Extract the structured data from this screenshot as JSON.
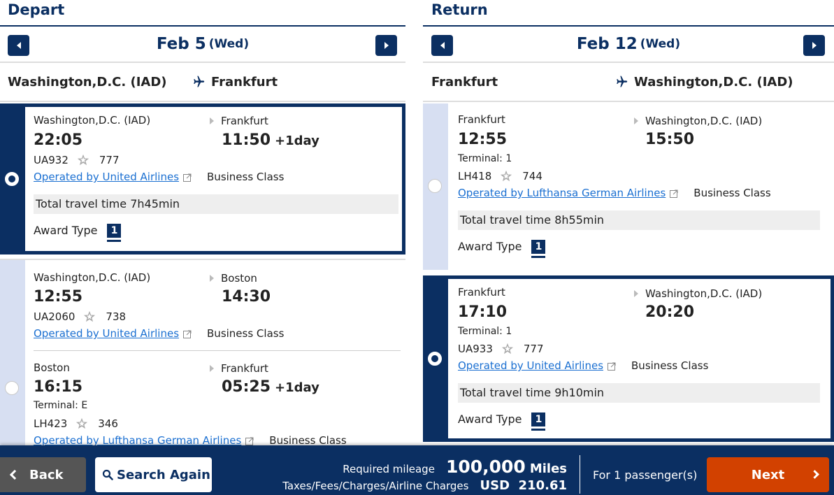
{
  "depart": {
    "title": "Depart",
    "date": "Feb 5",
    "dow": "(Wed)",
    "route_from": "Washington,D.C. (IAD)",
    "route_to": "Frankfurt",
    "options": [
      {
        "selected": true,
        "segments": [
          {
            "from": "Washington,D.C. (IAD)",
            "to": "Frankfurt",
            "dep_time": "22:05",
            "arr_time": "11:50",
            "arr_plus": "+1day",
            "terminal": "",
            "flight_no": "UA932",
            "aircraft": "777",
            "operator": "Operated by United Airlines",
            "cabin": "Business Class"
          }
        ],
        "total_time": "Total travel time 7h45min",
        "award_label": "Award Type",
        "award_value": "1"
      },
      {
        "selected": false,
        "segments": [
          {
            "from": "Washington,D.C. (IAD)",
            "to": "Boston",
            "dep_time": "12:55",
            "arr_time": "14:30",
            "arr_plus": "",
            "terminal": "",
            "flight_no": "UA2060",
            "aircraft": "738",
            "operator": "Operated by United Airlines",
            "cabin": "Business Class"
          },
          {
            "from": "Boston",
            "to": "Frankfurt",
            "dep_time": "16:15",
            "arr_time": "05:25",
            "arr_plus": "+1day",
            "terminal": "Terminal: E",
            "flight_no": "LH423",
            "aircraft": "346",
            "operator": "Operated by Lufthansa German Airlines",
            "cabin": "Business Class"
          }
        ]
      }
    ]
  },
  "return": {
    "title": "Return",
    "date": "Feb 12",
    "dow": "(Wed)",
    "route_from": "Frankfurt",
    "route_to": "Washington,D.C. (IAD)",
    "options": [
      {
        "selected": false,
        "segments": [
          {
            "from": "Frankfurt",
            "to": "Washington,D.C. (IAD)",
            "dep_time": "12:55",
            "arr_time": "15:50",
            "arr_plus": "",
            "terminal": "Terminal: 1",
            "flight_no": "LH418",
            "aircraft": "744",
            "operator": "Operated by Lufthansa German Airlines",
            "cabin": "Business Class"
          }
        ],
        "total_time": "Total travel time 8h55min",
        "award_label": "Award Type",
        "award_value": "1"
      },
      {
        "selected": true,
        "segments": [
          {
            "from": "Frankfurt",
            "to": "Washington,D.C. (IAD)",
            "dep_time": "17:10",
            "arr_time": "20:20",
            "arr_plus": "",
            "terminal": "Terminal: 1",
            "flight_no": "UA933",
            "aircraft": "777",
            "operator": "Operated by United Airlines",
            "cabin": "Business Class"
          }
        ],
        "total_time": "Total travel time 9h10min",
        "award_label": "Award Type",
        "award_value": "1"
      }
    ]
  },
  "footer": {
    "back_label": "Back",
    "search_again_label": "Search Again",
    "mileage_label": "Required mileage",
    "mileage_value": "100,000",
    "mileage_unit": "Miles",
    "tax_label": "Taxes/Fees/Charges/Airline Charges",
    "tax_value": "USD  210.61",
    "passengers": "For 1 passenger(s)",
    "next_label": "Next"
  },
  "colors": {
    "brand_navy": "#0b2f62",
    "rail_light": "#d7dff2",
    "next_orange": "#d24100",
    "link_blue": "#1a6fd1"
  },
  "icons": {
    "nav_prev": "triangle-left-icon",
    "nav_next": "triangle-right-icon",
    "plane": "airplane-icon",
    "alliance": "star-alliance-icon",
    "external": "external-link-icon",
    "search": "magnifier-icon"
  }
}
